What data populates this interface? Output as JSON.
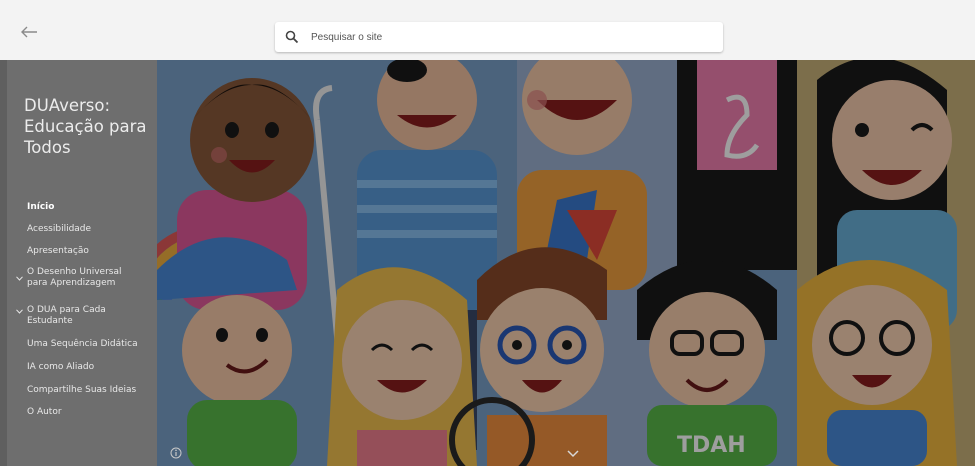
{
  "header": {
    "search_placeholder": "Pesquisar o site"
  },
  "sidebar": {
    "site_title": "DUAverso: Educação para Todos",
    "items": [
      {
        "label": "Início",
        "active": true
      },
      {
        "label": "Acessibilidade"
      },
      {
        "label": "Apresentação"
      },
      {
        "label": "O Desenho Universal para Aprendizagem",
        "lines": [
          "O Desenho Universal",
          "para Aprendizagem"
        ],
        "expandable": true
      },
      {
        "label": "O DUA para Cada Estudante",
        "lines": [
          "O DUA para Cada",
          "Estudante"
        ],
        "expandable": true
      },
      {
        "label": "Uma Sequência Didática"
      },
      {
        "label": "IA como Aliado"
      },
      {
        "label": "Compartilhe Suas Ideias"
      },
      {
        "label": "O Autor"
      }
    ]
  },
  "hero": {
    "shirt_text": "TDAH",
    "overlay_color": "#000000"
  }
}
